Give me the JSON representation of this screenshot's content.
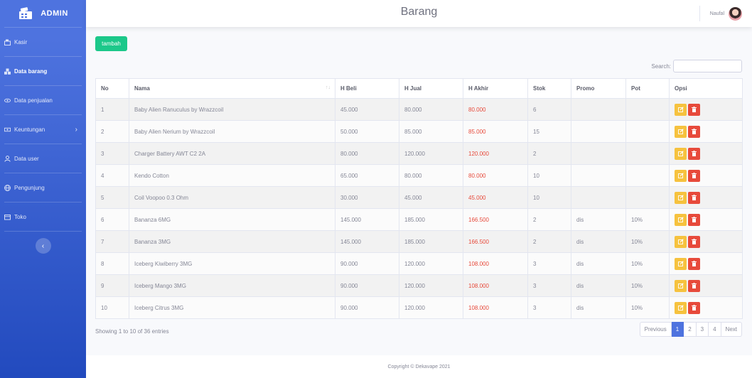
{
  "brand": {
    "title": "ADMIN"
  },
  "sidebar": {
    "items": [
      {
        "label": "Kasir",
        "icon": "cash-register-icon"
      },
      {
        "label": "Data barang",
        "icon": "cubes-icon",
        "active": true
      },
      {
        "label": "Data penjualan",
        "icon": "eye-icon"
      },
      {
        "label": "Keuntungan",
        "icon": "money-icon",
        "has_caret": true
      },
      {
        "label": "Data user",
        "icon": "user-icon"
      },
      {
        "label": "Pengunjung",
        "icon": "globe-icon"
      },
      {
        "label": "Toko",
        "icon": "store-icon"
      }
    ],
    "toggle_label": "‹"
  },
  "topbar": {
    "title": "Barang",
    "user_name": "Naufal"
  },
  "toolbar": {
    "add_label": "tambah",
    "search_label": "Search:",
    "search_value": ""
  },
  "table": {
    "columns": [
      "No",
      "Nama",
      "H Beli",
      "H Jual",
      "H Akhir",
      "Stok",
      "Promo",
      "Pot",
      "Opsi"
    ],
    "rows": [
      {
        "no": "1",
        "nama": "Baby Alien Ranuculus by Wrazzcoil",
        "beli": "45.000",
        "jual": "80.000",
        "akhir": "80.000",
        "stok": "6",
        "promo": "",
        "pot": ""
      },
      {
        "no": "2",
        "nama": "Baby Alien Nerium by Wrazzcoil",
        "beli": "50.000",
        "jual": "85.000",
        "akhir": "85.000",
        "stok": "15",
        "promo": "",
        "pot": ""
      },
      {
        "no": "3",
        "nama": "Charger Battery AWT C2 2A",
        "beli": "80.000",
        "jual": "120.000",
        "akhir": "120.000",
        "stok": "2",
        "promo": "",
        "pot": ""
      },
      {
        "no": "4",
        "nama": "Kendo Cotton",
        "beli": "65.000",
        "jual": "80.000",
        "akhir": "80.000",
        "stok": "10",
        "promo": "",
        "pot": ""
      },
      {
        "no": "5",
        "nama": "Coil Voopoo 0.3 Ohm",
        "beli": "30.000",
        "jual": "45.000",
        "akhir": "45.000",
        "stok": "10",
        "promo": "",
        "pot": ""
      },
      {
        "no": "6",
        "nama": "Bananza 6MG",
        "beli": "145.000",
        "jual": "185.000",
        "akhir": "166.500",
        "stok": "2",
        "promo": "dis",
        "pot": "10%"
      },
      {
        "no": "7",
        "nama": "Bananza 3MG",
        "beli": "145.000",
        "jual": "185.000",
        "akhir": "166.500",
        "stok": "2",
        "promo": "dis",
        "pot": "10%"
      },
      {
        "no": "8",
        "nama": "Iceberg Kiwiberry 3MG",
        "beli": "90.000",
        "jual": "120.000",
        "akhir": "108.000",
        "stok": "3",
        "promo": "dis",
        "pot": "10%"
      },
      {
        "no": "9",
        "nama": "Iceberg Mango 3MG",
        "beli": "90.000",
        "jual": "120.000",
        "akhir": "108.000",
        "stok": "3",
        "promo": "dis",
        "pot": "10%"
      },
      {
        "no": "10",
        "nama": "Iceberg Citrus 3MG",
        "beli": "90.000",
        "jual": "120.000",
        "akhir": "108.000",
        "stok": "3",
        "promo": "dis",
        "pot": "10%"
      }
    ]
  },
  "pagination": {
    "info": "Showing 1 to 10 of 36 entries",
    "previous": "Previous",
    "pages": [
      "1",
      "2",
      "3",
      "4"
    ],
    "active_page": "1",
    "next": "Next"
  },
  "footer": {
    "text": "Copyright © Dekavape 2021"
  },
  "colors": {
    "primary": "#4e73df",
    "success": "#1cc88a",
    "warning": "#f6c23e",
    "danger": "#e74a3b"
  }
}
